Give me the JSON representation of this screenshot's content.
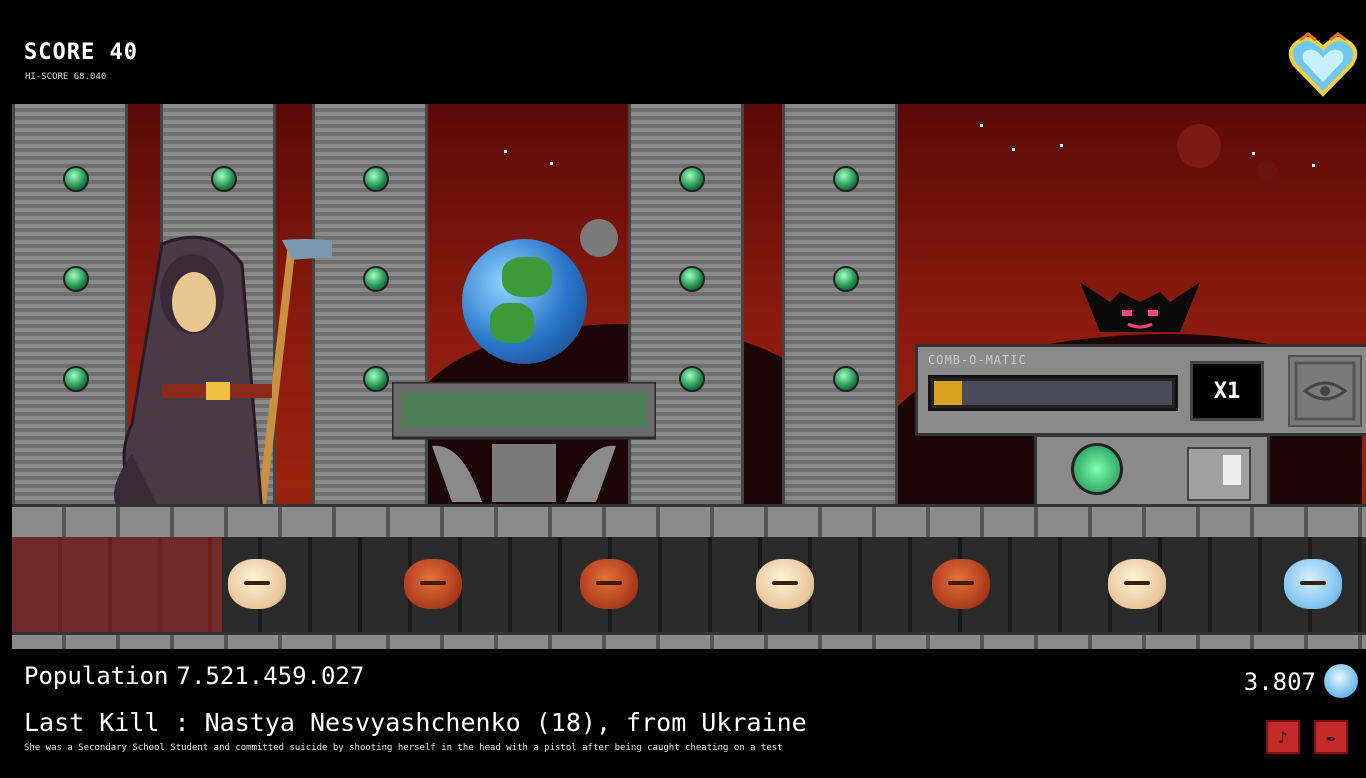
{
  "hud": {
    "score_label": "SCORE 40",
    "hiscore_label": "HI-SCORE 68.040",
    "population_label": "Population",
    "population_value": "7.521.459.027",
    "souls_count": "3.807",
    "last_kill_label": "Last Kill : Nastya Nesvyashchenko (18), from Ukraine",
    "last_kill_description": "She was a Secondary School Student and committed suicide by shooting herself in the head with a pistol after being caught cheating on a test"
  },
  "combo": {
    "label": "COMB-O-MATIC",
    "multiplier": "X1",
    "fill_fraction": 0.12,
    "fill_color": "#d8a020"
  },
  "souls_row": [
    "spawner",
    "good",
    "evil",
    "evil",
    "good",
    "evil",
    "good",
    "blue"
  ],
  "icons": {
    "heart": "heart-icon",
    "sound": "sound-muted-icon",
    "music": "music-muted-icon"
  },
  "colors": {
    "sky_red": "#8a1a0e",
    "toggle_red": "#c42a2a",
    "gem_green": "#1c8a4a"
  }
}
